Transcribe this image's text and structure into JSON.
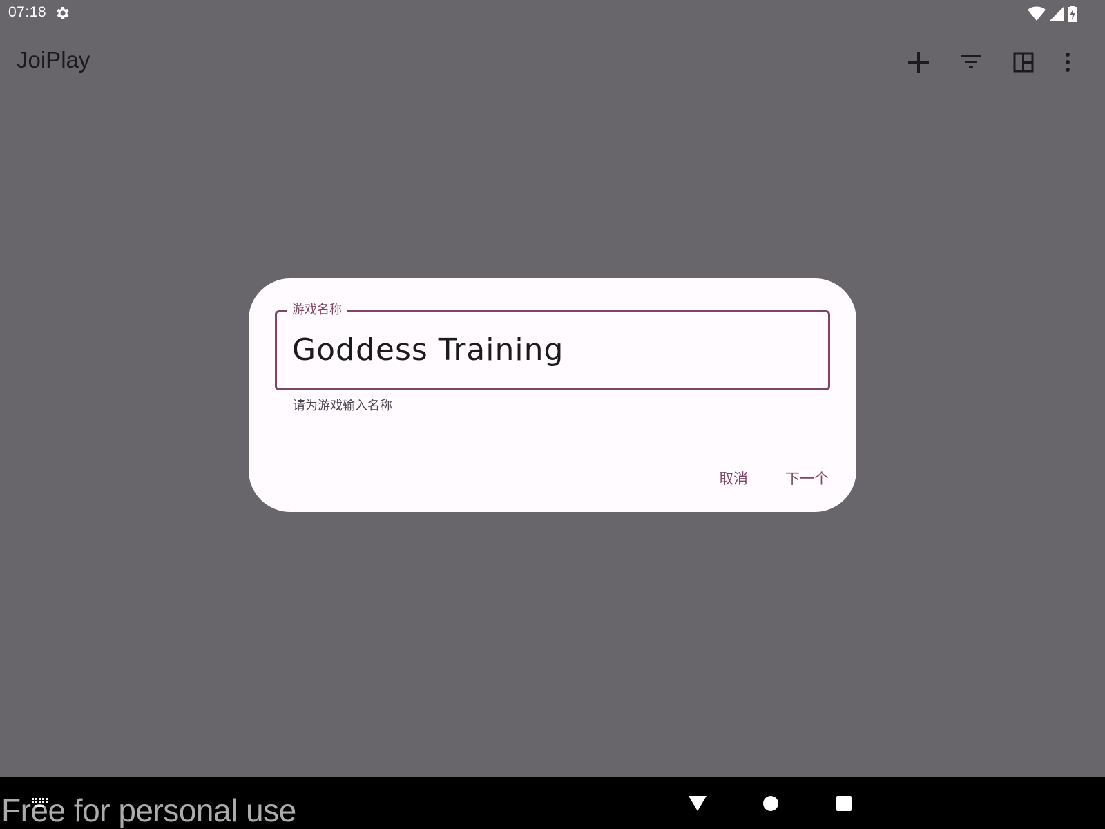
{
  "status_bar": {
    "time": "07:18",
    "icons": [
      "settings-gear-icon",
      "wifi-icon",
      "cellular-signal-icon",
      "battery-charging-icon"
    ]
  },
  "app_bar": {
    "title": "JoiPlay",
    "actions": [
      "add-icon",
      "filter-icon",
      "layout-icon",
      "more-vert-icon"
    ]
  },
  "dialog": {
    "field_label": "游戏名称",
    "field_value": "Goddess Training",
    "helper_text": "请为游戏输入名称",
    "cancel_label": "取消",
    "next_label": "下一个"
  },
  "nav_bar": {
    "buttons": [
      "back-icon",
      "home-icon",
      "recents-icon"
    ]
  },
  "watermark": "Free for personal use",
  "colors": {
    "scrim": "#68666b",
    "accent": "#7d4665",
    "dialog_bg": "#fffbfe",
    "text_primary": "#1b1b1f"
  }
}
